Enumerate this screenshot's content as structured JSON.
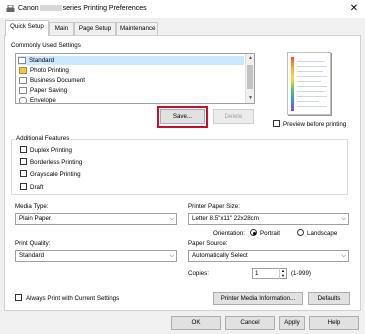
{
  "window": {
    "title_prefix": "Canon",
    "title_suffix": "series Printing Preferences",
    "close_glyph": "✕"
  },
  "tabs": [
    {
      "label": "Quick Setup"
    },
    {
      "label": "Main"
    },
    {
      "label": "Page Setup"
    },
    {
      "label": "Maintenance"
    }
  ],
  "commonly_used": {
    "group_label": "Commonly Used Settings",
    "items": [
      {
        "label": "Standard",
        "icon": "standard-doc-icon"
      },
      {
        "label": "Photo Printing",
        "icon": "photo-icon"
      },
      {
        "label": "Business Document",
        "icon": "business-doc-icon"
      },
      {
        "label": "Paper Saving",
        "icon": "paper-saving-icon"
      },
      {
        "label": "Envelope",
        "icon": "envelope-icon"
      }
    ],
    "save_label": "Save...",
    "delete_label": "Delete"
  },
  "preview": {
    "checkbox_label": "Preview before printing"
  },
  "additional_features": {
    "group_label": "Additional Features",
    "items": [
      {
        "label": "Duplex Printing"
      },
      {
        "label": "Borderless Printing"
      },
      {
        "label": "Grayscale Printing"
      },
      {
        "label": "Draft"
      }
    ]
  },
  "media_type": {
    "label": "Media Type:",
    "value": "Plain Paper"
  },
  "printer_paper_size": {
    "label": "Printer Paper Size:",
    "value": "Letter 8.5\"x11\" 22x28cm"
  },
  "orientation": {
    "label": "Orientation:",
    "portrait": "Portrait",
    "landscape": "Landscape",
    "selected": "Portrait"
  },
  "print_quality": {
    "label": "Print Quality:",
    "value": "Standard"
  },
  "paper_source": {
    "label": "Paper Source:",
    "value": "Automatically Select"
  },
  "copies": {
    "label": "Copies:",
    "value": "1",
    "range": "(1-999)"
  },
  "always_print_label": "Always Print with Current Settings",
  "printer_media_info_label": "Printer Media Information...",
  "defaults_label": "Defaults",
  "footer": {
    "ok": "OK",
    "cancel": "Cancel",
    "apply": "Apply",
    "help": "Help"
  },
  "colors": {
    "highlight": "#c8102e",
    "selection": "#cce8ff"
  }
}
